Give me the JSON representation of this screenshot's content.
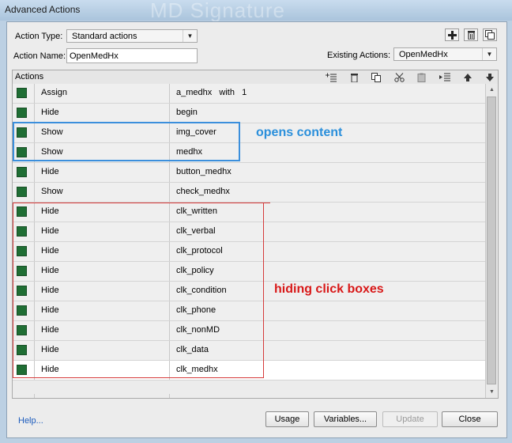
{
  "window": {
    "title": "Advanced Actions",
    "background_title": "MD Signature"
  },
  "form": {
    "action_type_label": "Action Type:",
    "action_type_value": "Standard actions",
    "action_name_label": "Action Name:",
    "action_name_value": "OpenMedHx",
    "existing_actions_label": "Existing Actions:",
    "existing_actions_value": "OpenMedHx"
  },
  "top_icons": [
    "add-icon",
    "trash-icon",
    "duplicate-icon"
  ],
  "grid": {
    "header_label": "Actions",
    "toolbar_icons": [
      "insert-action-icon",
      "delete-icon",
      "copy-icon",
      "cut-icon",
      "paste-icon",
      "indent-icon",
      "move-up-icon",
      "move-down-icon"
    ],
    "rows": [
      {
        "action": "Assign",
        "target": "a_medhx   with   1"
      },
      {
        "action": "Hide",
        "target": "begin"
      },
      {
        "action": "Show",
        "target": "img_cover"
      },
      {
        "action": "Show",
        "target": "medhx"
      },
      {
        "action": "Hide",
        "target": "button_medhx"
      },
      {
        "action": "Show",
        "target": "check_medhx"
      },
      {
        "action": "Hide",
        "target": "clk_written"
      },
      {
        "action": "Hide",
        "target": "clk_verbal"
      },
      {
        "action": "Hide",
        "target": "clk_protocol"
      },
      {
        "action": "Hide",
        "target": "clk_policy"
      },
      {
        "action": "Hide",
        "target": "clk_condition"
      },
      {
        "action": "Hide",
        "target": "clk_phone"
      },
      {
        "action": "Hide",
        "target": "clk_nonMD"
      },
      {
        "action": "Hide",
        "target": "clk_data"
      },
      {
        "action": "Hide",
        "target": "clk_medhx"
      }
    ],
    "selected_row": 14
  },
  "annotations": {
    "blue_text": "opens content",
    "blue_color": "#2a8fdb",
    "red_text": "hiding click boxes",
    "red_color": "#d81818"
  },
  "footer": {
    "help_link": "Help...",
    "usage_button": "Usage",
    "variables_button": "Variables...",
    "update_button": "Update",
    "close_button": "Close"
  },
  "colors": {
    "checkbox_green": "#1f6e34",
    "title_bar": "#bcd0e3"
  }
}
